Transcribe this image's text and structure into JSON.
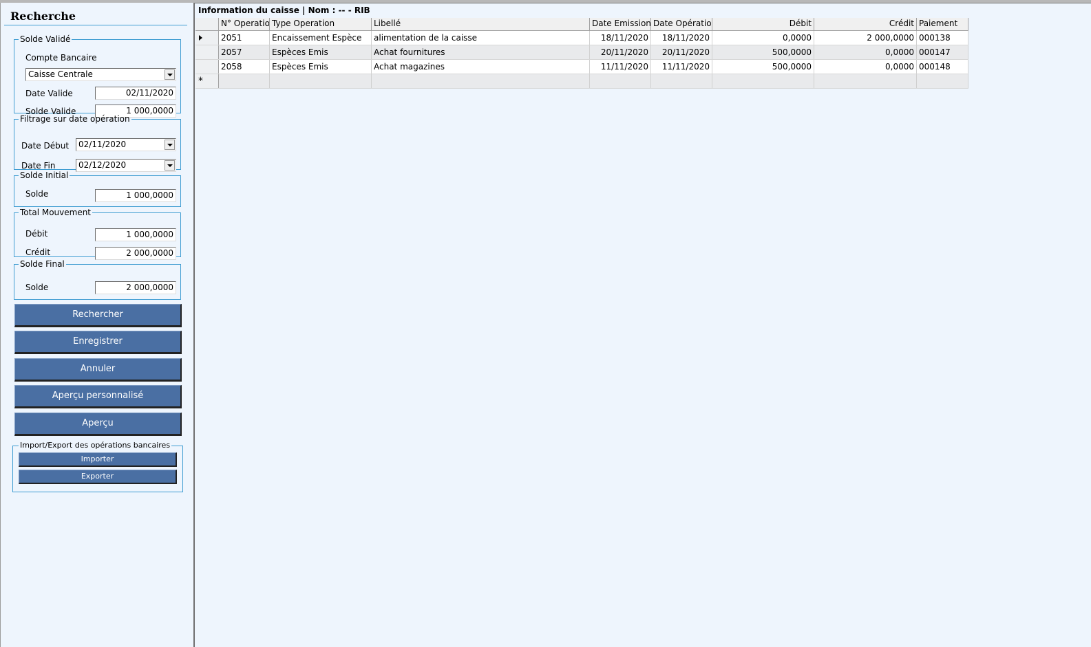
{
  "search_panel": {
    "title": "Recherche",
    "solde_valide": {
      "legend": "Solde Validé",
      "compte_label": "Compte Bancaire",
      "compte_value": "Caisse Centrale",
      "date_label": "Date Valide",
      "date_value": "02/11/2020",
      "solde_label": "Solde Valide",
      "solde_value": "1 000,0000"
    },
    "filtrage": {
      "legend": "Filtrage sur date opération",
      "debut_label": "Date Début",
      "debut_value": "02/11/2020",
      "fin_label": "Date Fin",
      "fin_value": "02/12/2020"
    },
    "solde_initial": {
      "legend": "Solde Initial",
      "label": "Solde",
      "value": "1 000,0000"
    },
    "total_mouvement": {
      "legend": "Total Mouvement",
      "debit_label": "Débit",
      "debit_value": "1 000,0000",
      "credit_label": "Crédit",
      "credit_value": "2 000,0000"
    },
    "solde_final": {
      "legend": "Solde Final",
      "label": "Solde",
      "value": "2 000,0000"
    },
    "buttons": {
      "rechercher": "Rechercher",
      "enregistrer": "Enregistrer",
      "annuler": "Annuler",
      "apercu_perso": "Aperçu personnalisé",
      "apercu": "Aperçu"
    },
    "import_export": {
      "legend": "Import/Export des opérations bancaires",
      "importer": "Importer",
      "exporter": "Exporter"
    }
  },
  "grid": {
    "title": "Information du caisse | Nom : -- - RIB",
    "columns": [
      "N° Operatio",
      "Type Operation",
      "Libellé",
      "Date Emission",
      "Date Opératio",
      "Débit",
      "Crédit",
      "Paiement"
    ],
    "rows": [
      [
        "2051",
        "Encaissement Espèce",
        "alimentation de la caisse",
        "18/11/2020",
        "18/11/2020",
        "0,0000",
        "2 000,0000",
        "000138"
      ],
      [
        "2057",
        "Espèces Emis",
        "Achat fournitures",
        "20/11/2020",
        "20/11/2020",
        "500,0000",
        "0,0000",
        "000147"
      ],
      [
        "2058",
        "Espèces Emis",
        "Achat magazines",
        "11/11/2020",
        "11/11/2020",
        "500,0000",
        "0,0000",
        "000148"
      ]
    ],
    "new_row_marker": "*"
  }
}
